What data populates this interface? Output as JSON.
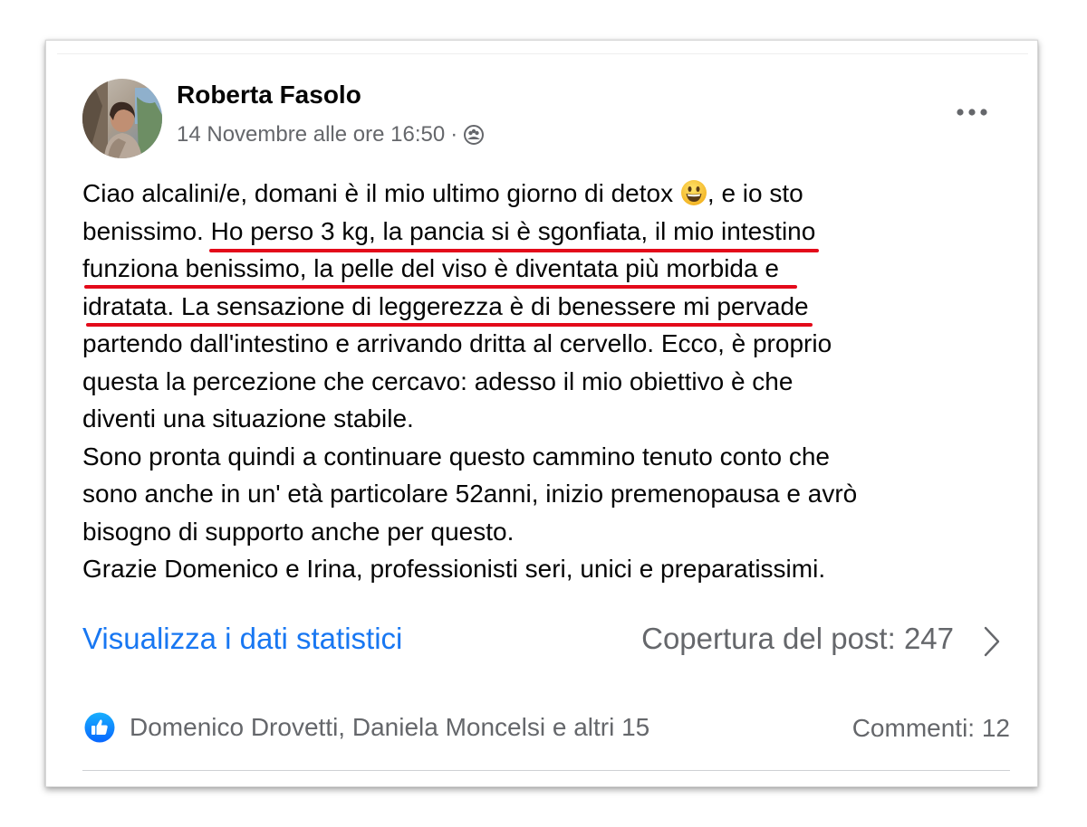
{
  "post": {
    "author": "Roberta Fasolo",
    "timestamp": "14 Novembre alle ore 16:50",
    "separator": "·",
    "audience_icon": "group-audience-icon",
    "more_icon": "more-options-icon",
    "body": {
      "l1a": "Ciao alcalini/e, domani è il mio ultimo giorno di detox ",
      "emoji": "grinning-face-emoji",
      "l1b": ", e io sto",
      "l2a": "benissimo. ",
      "l2b": "Ho perso 3 kg, la pancia si è sgonfiata, il mio intestino",
      "l3": "funziona benissimo, la pelle del viso è diventata più morbida e",
      "l4": "idratata. La sensazione di leggerezza è di benessere mi pervade",
      "l5": "partendo dall'intestino e arrivando dritta al cervello. Ecco, è proprio",
      "l6": "questa la percezione che cercavo: adesso il mio obiettivo è che",
      "l7": "diventi una situazione stabile.",
      "l8": "Sono pronta quindi a continuare questo cammino tenuto conto che",
      "l9": "sono anche in un' età particolare 52anni, inizio premenopausa e avrò",
      "l10": "bisogno di supporto anche per questo.",
      "l11": "Grazie Domenico e Irina, professionisti seri, unici e preparatissimi."
    },
    "highlight_color": "#e30a1a"
  },
  "insights": {
    "link_label": "Visualizza i dati statistici",
    "reach_label": "Copertura del post: 247",
    "chevron_icon": "chevron-right-icon"
  },
  "engagement": {
    "like_icon": "like-thumbs-up-icon",
    "reactors": "Domenico Drovetti, Daniela Moncelsi e altri 15",
    "comments": "Commenti: 12"
  },
  "colors": {
    "link": "#1877f2",
    "secondary_text": "#65676b",
    "primary_text": "#050505"
  }
}
